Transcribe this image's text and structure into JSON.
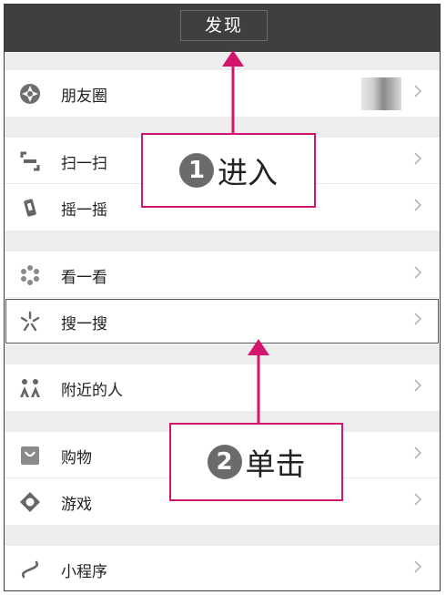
{
  "header": {
    "title": "发现"
  },
  "groups": [
    {
      "items": [
        {
          "label": "朋友圈",
          "icon": "moments-icon"
        }
      ]
    },
    {
      "items": [
        {
          "label": "扫一扫",
          "icon": "scan-icon"
        },
        {
          "label": "摇一摇",
          "icon": "shake-icon"
        }
      ]
    },
    {
      "items": [
        {
          "label": "看一看",
          "icon": "top-stories-icon"
        },
        {
          "label": "搜一搜",
          "icon": "search-icon"
        }
      ]
    },
    {
      "items": [
        {
          "label": "附近的人",
          "icon": "people-nearby-icon"
        }
      ]
    },
    {
      "items": [
        {
          "label": "购物",
          "icon": "shopping-icon"
        },
        {
          "label": "游戏",
          "icon": "games-icon"
        }
      ]
    },
    {
      "items": [
        {
          "label": "小程序",
          "icon": "mini-programs-icon"
        }
      ]
    }
  ],
  "callouts": [
    {
      "number": "1",
      "text": "进入"
    },
    {
      "number": "2",
      "text": "单击"
    }
  ],
  "colors": {
    "header": "#3f3f3f",
    "accent": "#d2166d",
    "background": "#ededed"
  }
}
